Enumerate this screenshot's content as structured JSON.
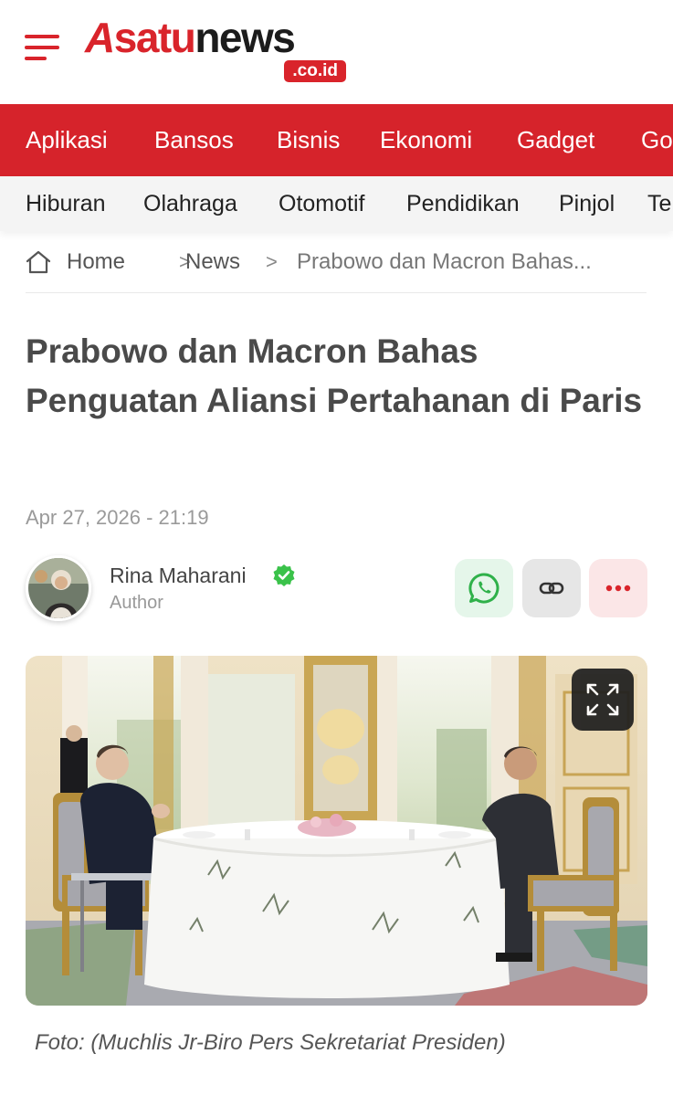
{
  "header": {
    "logo_text_a": "A",
    "logo_text_satu": "satu",
    "logo_text_news": "news",
    "logo_domain": ".co.id",
    "brand_color": "#d9242b"
  },
  "nav_primary": [
    {
      "label": "Aplikasi"
    },
    {
      "label": "Bansos"
    },
    {
      "label": "Bisnis"
    },
    {
      "label": "Ekonomi"
    },
    {
      "label": "Gadget"
    },
    {
      "label": "Go"
    }
  ],
  "nav_secondary": [
    {
      "label": "Hiburan"
    },
    {
      "label": "Olahraga"
    },
    {
      "label": "Otomotif"
    },
    {
      "label": "Pendidikan"
    },
    {
      "label": "Pinjol"
    },
    {
      "label": "Te"
    }
  ],
  "breadcrumb": {
    "home": "Home",
    "section": "News",
    "current": "Prabowo dan Macron Bahas...",
    "separator": ">"
  },
  "article": {
    "title": "Prabowo dan Macron Bahas Penguatan Aliansi Pertahanan di Paris",
    "date": "Apr 27, 2026 - 21:19",
    "author_name": "Rina Maharani",
    "author_role": "Author",
    "photo_caption": "Foto: (Muchlis Jr-Biro Pers Sekretariat Presiden)"
  },
  "icons": {
    "menu": "hamburger-menu-icon",
    "home": "home-icon",
    "verified": "verified-check-icon",
    "whatsapp": "whatsapp-icon",
    "link": "link-icon",
    "more": "more-dots-icon",
    "expand": "expand-icon"
  }
}
